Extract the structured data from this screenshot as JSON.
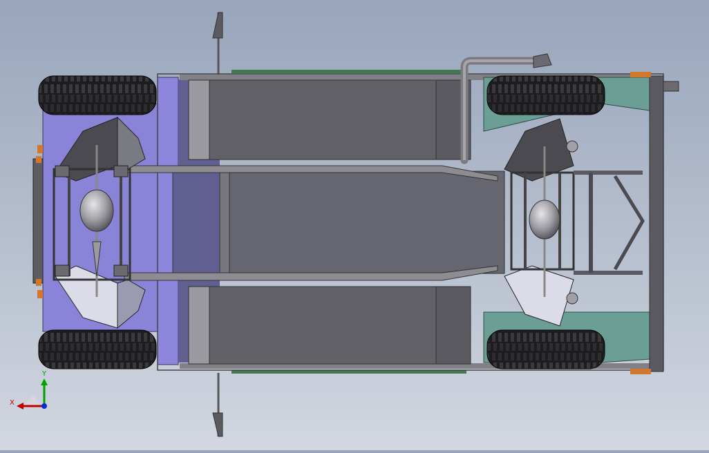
{
  "view": {
    "background_top": "#98a5bb",
    "background_bottom": "#d2d7e0"
  },
  "model": {
    "frame_color": "#5f5f66",
    "body_panel_color": "#6e6e74",
    "front_frame_color": "#8a84d8",
    "rear_panel_color": "#6b9f95",
    "tire_color": "#1d1d1f",
    "differential_color": "#a9a9ae",
    "bumper_accent_color": "#d2782a",
    "skid_color": "#dcdce8",
    "pipe_color": "#8e8e92"
  },
  "triad": {
    "x_label": "X",
    "y_label": "Y",
    "x_color": "#c00000",
    "y_color": "#00a000",
    "z_color": "#0030d0"
  }
}
